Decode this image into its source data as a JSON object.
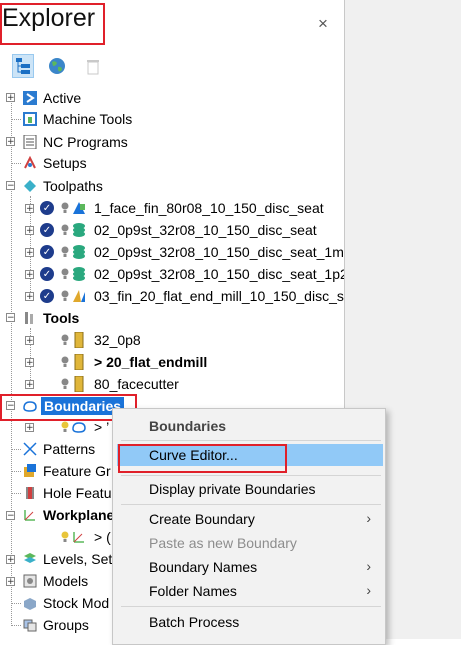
{
  "panel": {
    "title": "Explorer",
    "close_glyph": "×"
  },
  "toolbar": {
    "icons": [
      "tree-view-icon",
      "globe-icon",
      "trash-icon"
    ]
  },
  "tree": {
    "active": "Active",
    "machine_tools": "Machine Tools",
    "nc_programs": "NC Programs",
    "setups": "Setups",
    "toolpaths": "Toolpaths",
    "toolpath_items": [
      "1_face_fin_80r08_10_150_disc_seat",
      "02_0p9st_32r08_10_150_disc_seat",
      "02_0p9st_32r08_10_150_disc_seat_1m",
      "02_0p9st_32r08_10_150_disc_seat_1p2",
      "03_fin_20_flat_end_mill_10_150_disc_s"
    ],
    "tools": "Tools",
    "tool_items": [
      "32_0p8",
      "> 20_flat_endmill",
      "80_facecutter"
    ],
    "boundaries": "Boundaries",
    "boundary_child": "> ’",
    "patterns": "Patterns",
    "feature_groups": "Feature Gr",
    "hole_features": "Hole Featu",
    "workplanes": "Workplane",
    "workplane_child": "> (",
    "levels": "Levels, Set",
    "models": "Models",
    "stock_models": "Stock Mod",
    "groups": "Groups"
  },
  "context_menu": {
    "header": "Boundaries",
    "items": {
      "curve_editor": "Curve Editor...",
      "display_private": "Display private Boundaries",
      "create_boundary": "Create Boundary",
      "paste_new": "Paste as new Boundary",
      "boundary_names": "Boundary Names",
      "folder_names": "Folder Names",
      "batch_process": "Batch Process"
    },
    "submenu_arrow": "›"
  },
  "colors": {
    "highlight_red": "#e0202a",
    "menu_hover": "#91c9f7",
    "selection_blue": "#1a73d9"
  }
}
